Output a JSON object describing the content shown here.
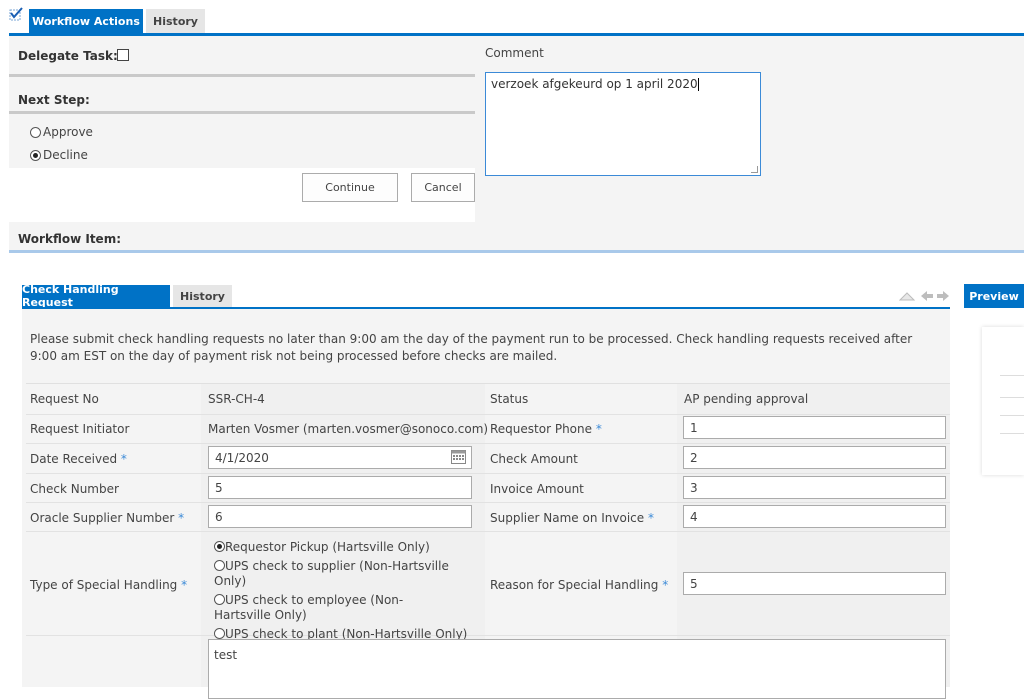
{
  "top_tabs": {
    "active": "Workflow Actions",
    "inactive": "History"
  },
  "delegate": {
    "label": "Delegate Task:"
  },
  "next_step": {
    "label": "Next Step:",
    "options": [
      {
        "label": "Approve",
        "selected": false
      },
      {
        "label": "Decline",
        "selected": true
      }
    ]
  },
  "buttons": {
    "continue": "Continue",
    "cancel": "Cancel"
  },
  "comment": {
    "label": "Comment",
    "value": "verzoek afgekeurd op 1 april 2020"
  },
  "workflow_item": {
    "label": "Workflow Item:"
  },
  "form_tabs": {
    "active": "Check Handling Request",
    "inactive": "History"
  },
  "preview": {
    "label": "Preview"
  },
  "notice": "Please submit check handling requests no later than 9:00 am the day of the payment run to be processed. Check handling requests received after 9:00 am EST on the day of payment risk not being processed before checks are mailed.",
  "required_marker": "*",
  "fields": {
    "request_no": {
      "label": "Request No",
      "value": "SSR-CH-4"
    },
    "status": {
      "label": "Status",
      "value": "AP pending approval"
    },
    "request_initiator": {
      "label": "Request Initiator",
      "value": "Marten Vosmer (marten.vosmer@sonoco.com)"
    },
    "requestor_phone": {
      "label": "Requestor Phone",
      "value": "1"
    },
    "date_received": {
      "label": "Date Received",
      "value": "4/1/2020"
    },
    "check_amount": {
      "label": "Check Amount",
      "value": "2"
    },
    "check_number": {
      "label": "Check Number",
      "value": "5"
    },
    "invoice_amount": {
      "label": "Invoice Amount",
      "value": "3"
    },
    "oracle_supplier_number": {
      "label": "Oracle Supplier Number",
      "value": "6"
    },
    "supplier_name_on_invoice": {
      "label": "Supplier Name on Invoice",
      "value": "4"
    },
    "type_of_special_handling": {
      "label": "Type of Special Handling",
      "options": [
        {
          "label": "Requestor Pickup (Hartsville Only)",
          "selected": true
        },
        {
          "label": "UPS check to supplier (Non-Hartsville Only)",
          "selected": false
        },
        {
          "label": "UPS check to employee (Non-Hartsville Only)",
          "selected": false
        },
        {
          "label": "UPS check to plant (Non-Hartsville Only)",
          "selected": false
        }
      ]
    },
    "reason_for_special_handling": {
      "label": "Reason for Special Handling",
      "value": "5"
    },
    "notes": {
      "value": "test"
    }
  }
}
